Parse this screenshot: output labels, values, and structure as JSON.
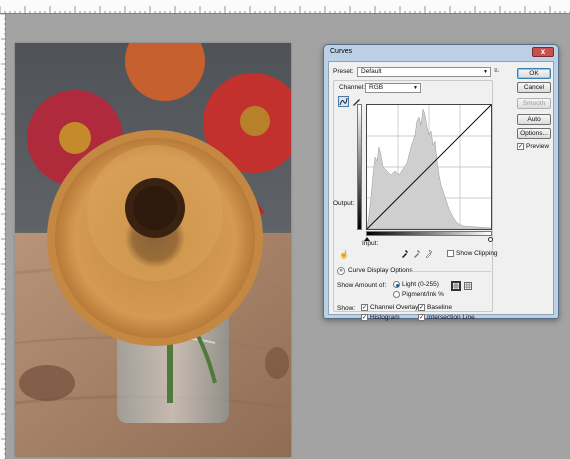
{
  "dialog": {
    "title": "Curves",
    "close_glyph": "x",
    "preset_label": "Preset:",
    "preset_value": "Default",
    "preset_menu_glyph": "≡.",
    "channel_label": "Channel:",
    "channel_value": "RGB",
    "output_label": "Output:",
    "input_label": "Input:",
    "show_clipping_label": "Show Clipping",
    "curve_display_options_label": "Curve Display Options",
    "show_amount_label": "Show Amount of:",
    "light_label": "Light  (0-255)",
    "pigment_label": "Pigment/Ink %",
    "show_label": "Show:",
    "channel_overlays_label": "Channel Overlays",
    "baseline_label": "Baseline",
    "histogram_label": "Histogram",
    "intersection_line_label": "Intersection Line",
    "preview_label": "Preview",
    "buttons": {
      "ok": "OK",
      "cancel": "Cancel",
      "smooth": "Smooth",
      "auto": "Auto",
      "options": "Options..."
    },
    "checkbox_states": {
      "preview": true,
      "show_clipping": false,
      "channel_overlays": true,
      "baseline": true,
      "histogram": true,
      "intersection_line": true
    },
    "show_amount_selected": "light"
  },
  "icons": {
    "curve_tool": "curve-icon",
    "pencil_tool": "pencil-icon",
    "black_eyedropper": "eyedropper-icon",
    "gray_eyedropper": "eyedropper-icon",
    "white_eyedropper": "eyedropper-icon",
    "target_adjust": "hand-adjust-icon"
  },
  "colors": {
    "dialog_frame": "#bcd0e6",
    "close_button": "#c75050",
    "canvas_bg": "#a3a3a3"
  }
}
